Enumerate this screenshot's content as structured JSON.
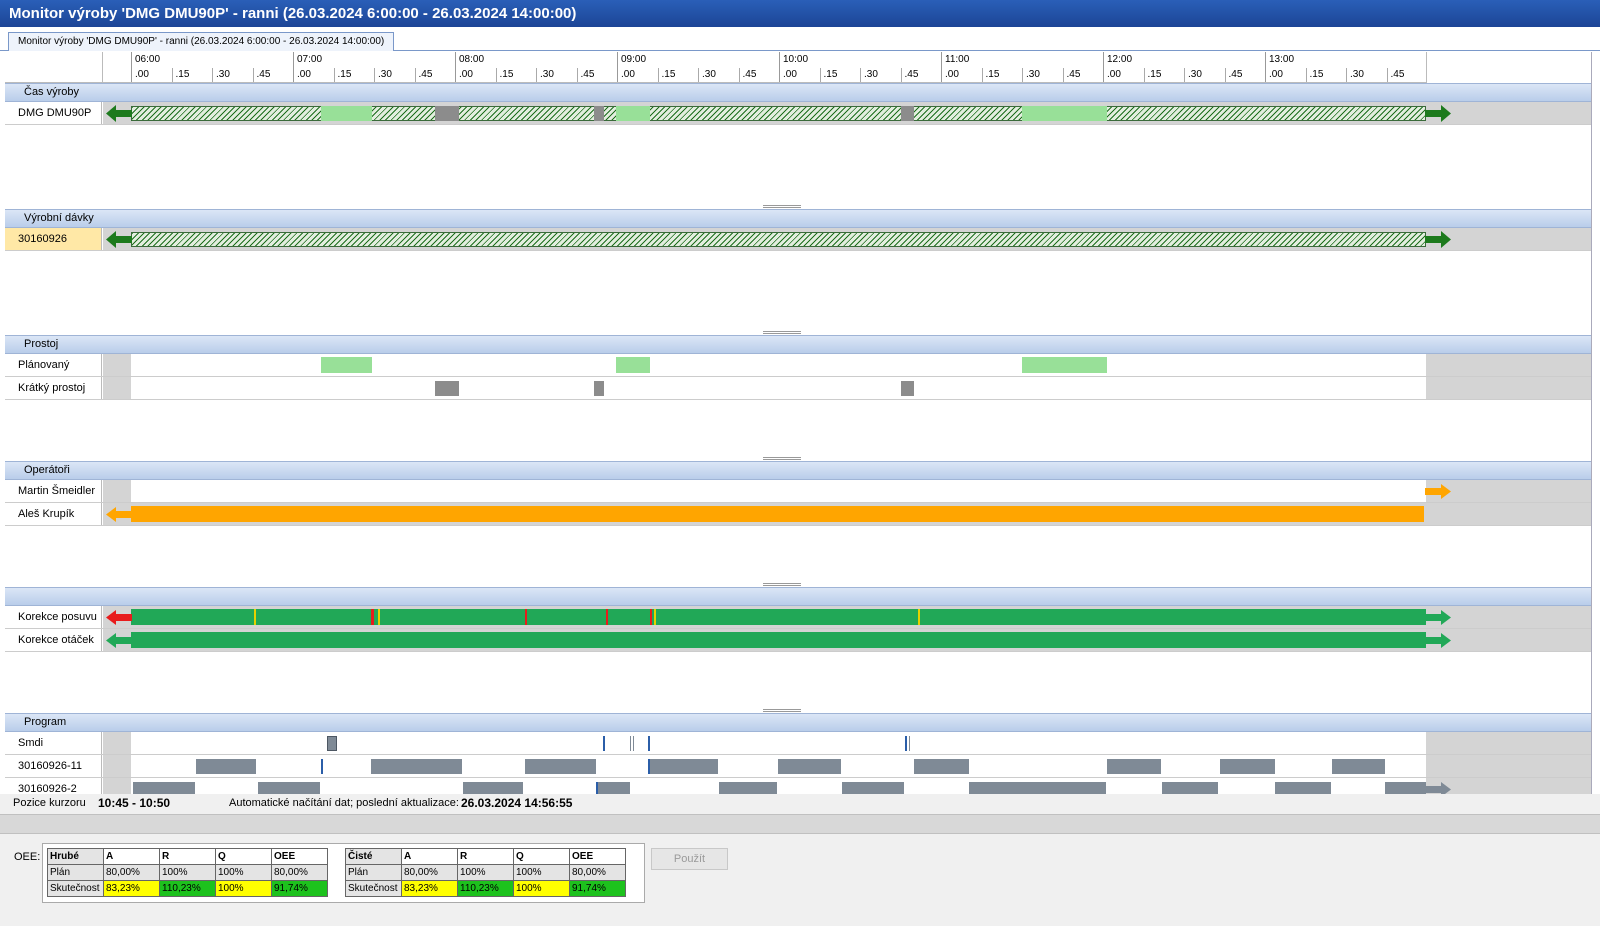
{
  "window": {
    "title": "Monitor výroby 'DMG DMU90P' - ranni  (26.03.2024 6:00:00 - 26.03.2024 14:00:00)"
  },
  "tab": {
    "label": "Monitor výroby 'DMG DMU90P' - ranni (26.03.2024 6:00:00 - 26.03.2024 14:00:00)"
  },
  "timeline": {
    "hours": [
      "06:00",
      "07:00",
      "08:00",
      "09:00",
      "10:00",
      "11:00",
      "12:00",
      "13:00"
    ],
    "quarters": [
      ".00",
      ".15",
      ".30",
      ".45"
    ]
  },
  "sections": {
    "cas": "Čas výroby",
    "davky": "Výrobní dávky",
    "prostoj": "Prostoj",
    "operatori": "Operátoři",
    "korekce": "",
    "program": "Program"
  },
  "rows": {
    "machine": "DMG DMU90P",
    "batch": "30160926",
    "planned": "Plánovaný",
    "short": "Krátký prostoj",
    "op1": "Martin Šmeidler",
    "op2": "Aleš Krupík",
    "feed": "Korekce posuvu",
    "speed": "Korekce otáček",
    "prog1": "Smdi",
    "prog2": "30160926-11",
    "prog3": "30160926-2"
  },
  "status": {
    "cursor_label": "Pozice kurzoru",
    "cursor_value": "10:45 - 10:50",
    "auto_label": "Automatické načítání dat; poslední aktualizace:",
    "auto_value": "26.03.2024 14:56:55"
  },
  "oee": {
    "label": "OEE:",
    "use_button": "Použít",
    "gross": {
      "header": [
        "Hrubé",
        "A",
        "R",
        "Q",
        "OEE"
      ],
      "plan": [
        "Plán",
        "80,00%",
        "100%",
        "100%",
        "80,00%"
      ],
      "actual": [
        "Skutečnost",
        "83,23%",
        "110,23%",
        "100%",
        "91,74%"
      ]
    },
    "net": {
      "header": [
        "Čisté",
        "A",
        "R",
        "Q",
        "OEE"
      ],
      "plan": [
        "Plán",
        "80,00%",
        "100%",
        "100%",
        "80,00%"
      ],
      "actual": [
        "Skutečnost",
        "83,23%",
        "110,23%",
        "100%",
        "91,74%"
      ]
    }
  },
  "colors": {
    "title": "#1c4596",
    "planned_downtime": "#98e098",
    "short_downtime": "#8c8c8c",
    "operator": "#ffa500",
    "correction_ok": "#21a857",
    "correction_alert": "#e81c1c",
    "arrow_green": "#1d7a1d",
    "program_block": "#7f8a96"
  }
}
